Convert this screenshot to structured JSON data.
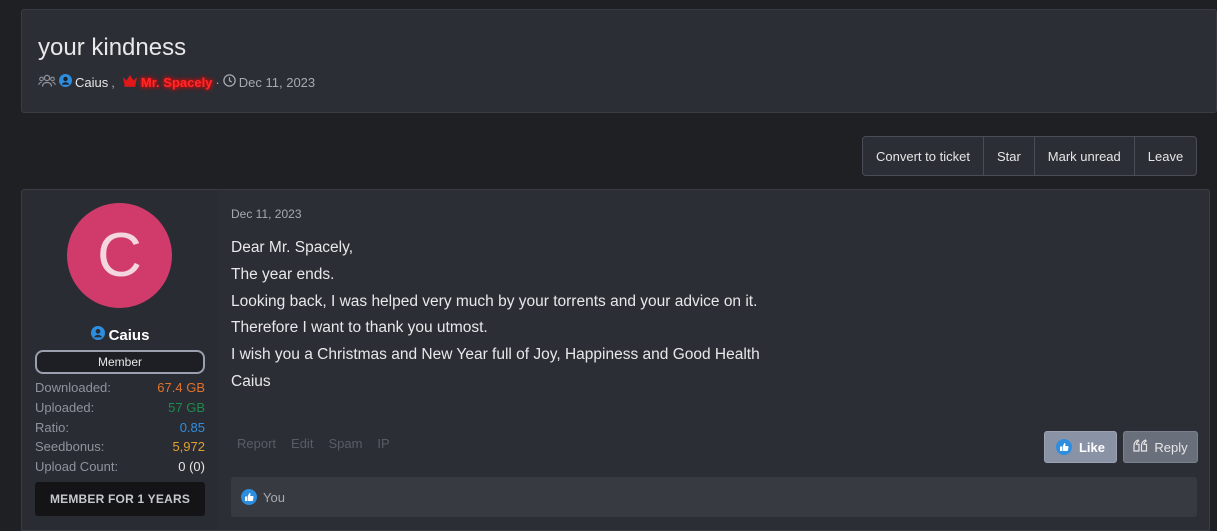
{
  "thread": {
    "title": "your kindness",
    "participant_1": "Caius",
    "participant_separator": ",",
    "participant_2": "Mr. Spacely",
    "dot": "·",
    "date": "Dec 11, 2023"
  },
  "actions": {
    "convert": "Convert to ticket",
    "star": "Star",
    "mark_unread": "Mark unread",
    "leave": "Leave"
  },
  "user": {
    "avatar_letter": "C",
    "name": "Caius",
    "role": "Member",
    "stats": [
      {
        "label": "Downloaded:",
        "value": "67.4 GB",
        "color": "#e0722b"
      },
      {
        "label": "Uploaded:",
        "value": "57 GB",
        "color": "#1f8a4c"
      },
      {
        "label": "Ratio:",
        "value": "0.85",
        "color": "#2f8fe0"
      },
      {
        "label": "Seedbonus:",
        "value": "5,972",
        "color": "#e0a030"
      },
      {
        "label": "Upload Count:",
        "value": "0 (0)",
        "color": "#e6e6e6"
      }
    ],
    "member_for": "MEMBER FOR 1 YEARS"
  },
  "post": {
    "date": "Dec 11, 2023",
    "lines": [
      "Dear Mr. Spacely,",
      "The year ends.",
      "Looking back, I was helped very much by your torrents and your advice on it.",
      "Therefore I want to thank you utmost.",
      "I wish you a Christmas and New Year full of Joy, Happiness and Good Health",
      "Caius"
    ],
    "links": {
      "report": "Report",
      "edit": "Edit",
      "spam": "Spam",
      "ip": "IP"
    },
    "like_label": "Like",
    "reply_label": "Reply",
    "likes_text": "You"
  },
  "icons": {
    "participants": "users-icon",
    "user": "user-circle-icon",
    "crown": "crown-icon",
    "clock": "clock-icon",
    "like": "thumbs-up-icon",
    "reply": "quote-icon"
  },
  "colors": {
    "accent_blue": "#2d8ee0",
    "admin_red": "#ff2a2a",
    "avatar_bg": "#d13b6b"
  }
}
